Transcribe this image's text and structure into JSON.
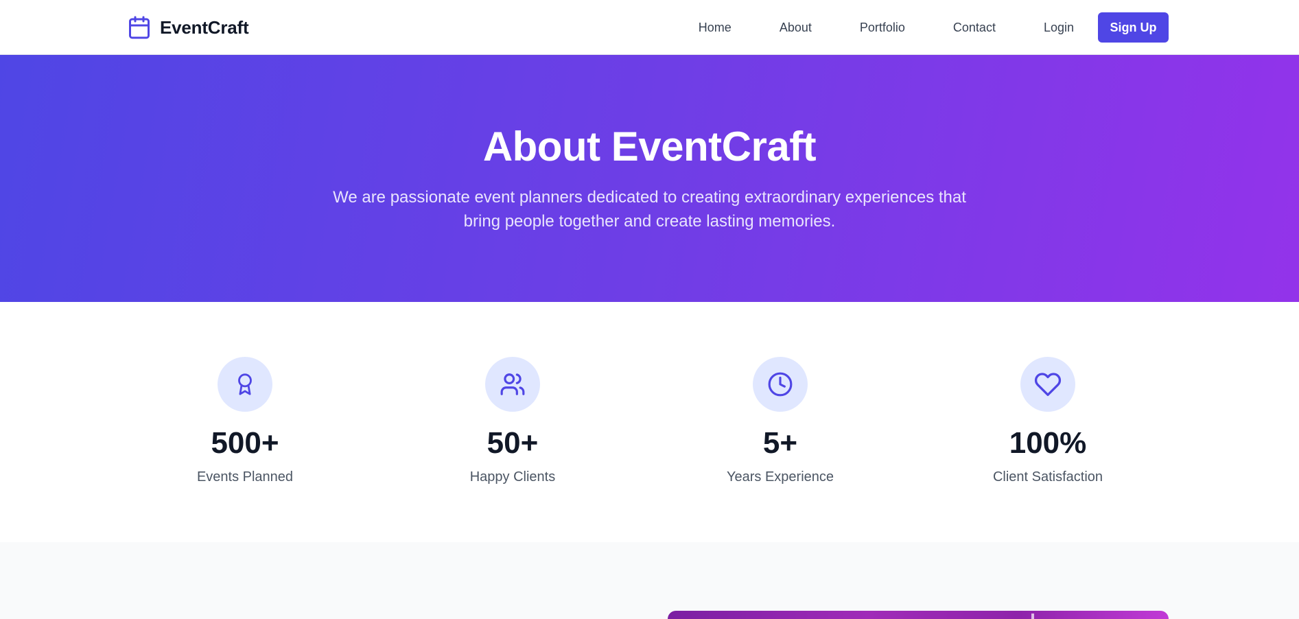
{
  "brand": {
    "name": "EventCraft",
    "icon": "calendar-icon",
    "accent": "#4f46e5"
  },
  "nav": {
    "links": [
      "Home",
      "About",
      "Portfolio",
      "Contact"
    ],
    "login": "Login",
    "signup": "Sign Up"
  },
  "hero": {
    "title": "About EventCraft",
    "subtitle": "We are passionate event planners dedicated to creating extraordinary experiences that bring people together and create lasting memories.",
    "gradient_start": "#4f46e5",
    "gradient_end": "#9333ea"
  },
  "stats": [
    {
      "icon": "award-icon",
      "value": "500+",
      "label": "Events Planned"
    },
    {
      "icon": "users-icon",
      "value": "50+",
      "label": "Happy Clients"
    },
    {
      "icon": "clock-icon",
      "value": "5+",
      "label": "Years Experience"
    },
    {
      "icon": "heart-icon",
      "value": "100%",
      "label": "Client Satisfaction"
    }
  ]
}
